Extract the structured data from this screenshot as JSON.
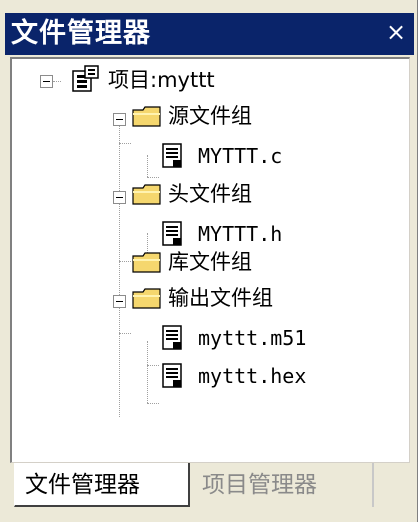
{
  "window": {
    "title": "文件管理器",
    "close_label": "×"
  },
  "tree": {
    "project_label": "项目:myttt",
    "groups": [
      {
        "label": "源文件组",
        "files": [
          "MYTTT.c"
        ]
      },
      {
        "label": "头文件组",
        "files": [
          "MYTTT.h"
        ]
      },
      {
        "label": "库文件组",
        "files": []
      },
      {
        "label": "输出文件组",
        "files": [
          "myttt.m51",
          "myttt.hex"
        ]
      }
    ]
  },
  "tabs": [
    {
      "label": "文件管理器",
      "active": true
    },
    {
      "label": "项目管理器",
      "active": false
    }
  ],
  "colors": {
    "titlebar": "#0a246a",
    "panel": "#ece9d8",
    "folder": "#f5d76e"
  }
}
